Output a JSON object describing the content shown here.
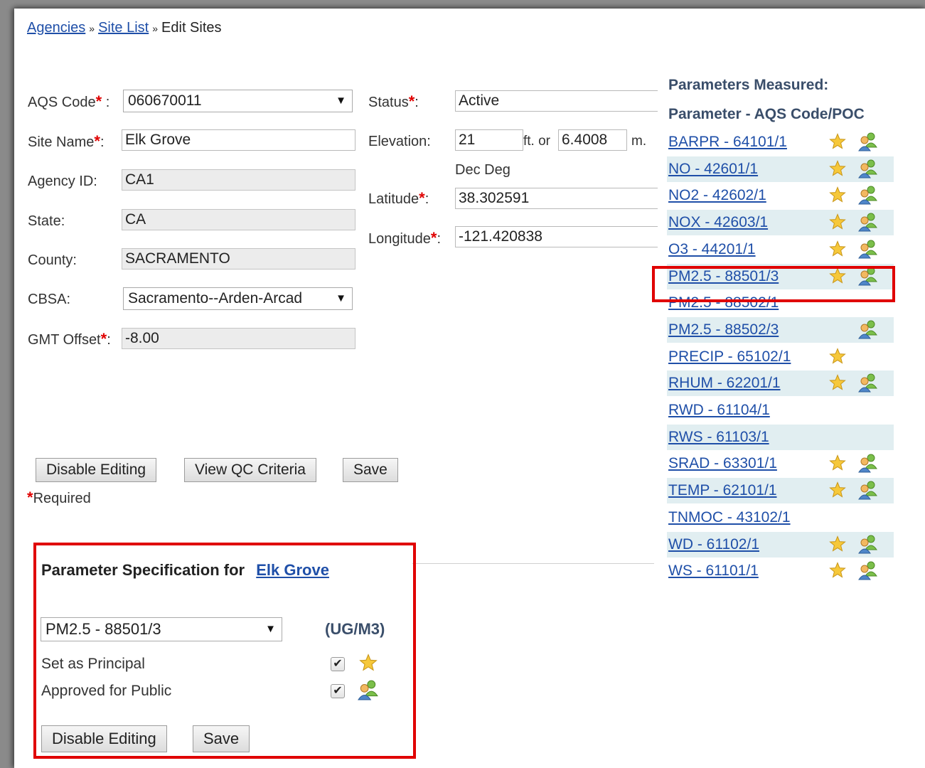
{
  "breadcrumb": {
    "agencies": "Agencies",
    "site_list": "Site List",
    "separator": "»",
    "current": "Edit Sites"
  },
  "form": {
    "aqs_code_label": "AQS Code",
    "aqs_code_colon": " :",
    "aqs_code_value": "060670011",
    "site_name_label": "Site Name",
    "site_name_colon": ":",
    "site_name_value": "Elk Grove",
    "agency_id_label": "Agency ID:",
    "agency_id_value": "CA1",
    "state_label": "State:",
    "state_value": "CA",
    "county_label": "County:",
    "county_value": "SACRAMENTO",
    "cbsa_label": "CBSA:",
    "cbsa_value": "Sacramento--Arden-Arcad",
    "gmt_label": "GMT Offset",
    "gmt_colon": ":",
    "gmt_value": "-8.00",
    "status_label": "Status",
    "status_colon": ":",
    "status_value": "Active",
    "elevation_label": "Elevation:",
    "elevation_ft": "21",
    "elevation_ft_unit": "ft. or",
    "elevation_m": "6.4008",
    "elevation_m_unit": "m.",
    "dec_deg": "Dec Deg",
    "latitude_label": "Latitude",
    "latitude_colon": ":",
    "latitude_value": "38.302591",
    "longitude_label": "Longitude",
    "longitude_colon": ":",
    "longitude_value": "-121.420838",
    "required_mark": "*",
    "required_text": "Required"
  },
  "buttons": {
    "disable_editing": "Disable Editing",
    "view_qc": "View QC Criteria",
    "save": "Save"
  },
  "parameters": {
    "heading": "Parameters Measured:",
    "subheading": "Parameter - AQS Code/POC",
    "items": [
      {
        "label": "BARPR - 64101/1",
        "principal": true,
        "public": true
      },
      {
        "label": "NO - 42601/1",
        "principal": true,
        "public": true
      },
      {
        "label": "NO2 - 42602/1",
        "principal": true,
        "public": true
      },
      {
        "label": "NOX - 42603/1",
        "principal": true,
        "public": true
      },
      {
        "label": "O3 - 44201/1",
        "principal": true,
        "public": true
      },
      {
        "label": "PM2.5 - 88501/3",
        "principal": true,
        "public": true
      },
      {
        "label": "PM2.5 - 88502/1",
        "principal": false,
        "public": false
      },
      {
        "label": "PM2.5 - 88502/3",
        "principal": false,
        "public": true
      },
      {
        "label": "PRECIP - 65102/1",
        "principal": true,
        "public": false
      },
      {
        "label": "RHUM - 62201/1",
        "principal": true,
        "public": true
      },
      {
        "label": "RWD - 61104/1",
        "principal": false,
        "public": false
      },
      {
        "label": "RWS - 61103/1",
        "principal": false,
        "public": false
      },
      {
        "label": "SRAD - 63301/1",
        "principal": true,
        "public": true
      },
      {
        "label": "TEMP - 62101/1",
        "principal": true,
        "public": true
      },
      {
        "label": "TNMOC - 43102/1",
        "principal": false,
        "public": false
      },
      {
        "label": "WD - 61102/1",
        "principal": true,
        "public": true
      },
      {
        "label": "WS - 61101/1",
        "principal": true,
        "public": true
      }
    ]
  },
  "spec": {
    "title": "Parameter Specification for",
    "site_link": "Elk Grove",
    "selected_param": "PM2.5 - 88501/3",
    "units": "(UG/M3)",
    "principal_label": "Set as Principal",
    "public_label": "Approved for Public",
    "principal_checked": true,
    "public_checked": true,
    "disable_editing": "Disable Editing",
    "save": "Save"
  },
  "colors": {
    "link": "#1f4fa8",
    "required": "#e00000",
    "highlight_box": "#e00000",
    "row_shade": "#e1eef1"
  }
}
